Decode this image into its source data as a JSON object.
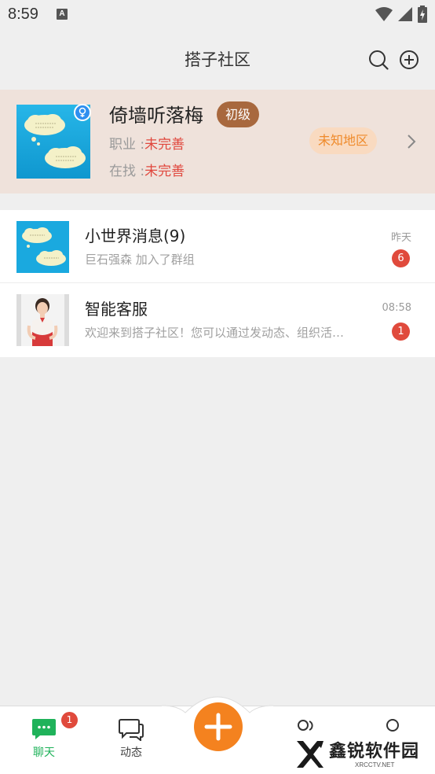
{
  "status_bar": {
    "time": "8:59",
    "notification_letter": "A"
  },
  "header": {
    "title": "搭子社区",
    "search_icon": "search-icon",
    "add_icon": "plus-circle-icon"
  },
  "profile": {
    "name": "倚墙听落梅",
    "level": "初级",
    "job_label": "职业 :",
    "job_value": "未完善",
    "seek_label": "在找 :",
    "seek_value": "未完善",
    "region": "未知地区",
    "gender_icon": "female-icon"
  },
  "chats": [
    {
      "title": "小世界消息(9)",
      "preview": "巨石强森 加入了群组",
      "time": "昨天",
      "unread": "6",
      "avatar": "speech-clouds-avatar"
    },
    {
      "title": "智能客服",
      "preview": "欢迎来到搭子社区！您可以通过发动态、组织活动、加入群组来结识新朋友",
      "time": "08:58",
      "unread": "1",
      "avatar": "service-agent-avatar"
    }
  ],
  "bottom_nav": {
    "chat_label": "聊天",
    "chat_badge": "1",
    "moments_label": "动态",
    "fab_icon": "plus-icon"
  },
  "watermark": {
    "text": "鑫锐软件园",
    "sub": "XRCCTV.NET"
  },
  "colors": {
    "accent_green": "#1fb25a",
    "accent_orange": "#f4821f",
    "badge_red": "#e04a3c",
    "level_brown": "#a8683e",
    "profile_bg": "#efe2db"
  }
}
